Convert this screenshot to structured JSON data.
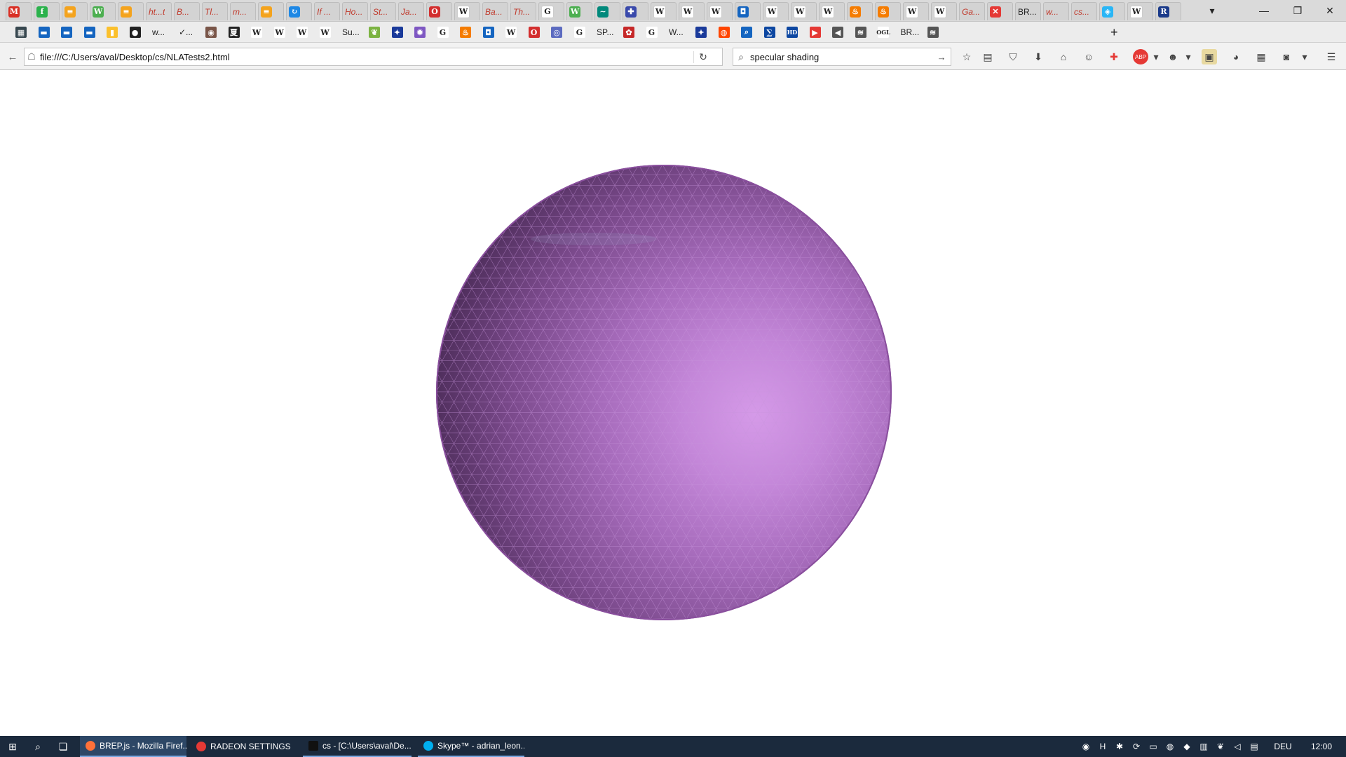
{
  "window": {
    "tabs": [
      {
        "title": "",
        "icon": "gmail-icon",
        "color": "#d93025",
        "glyph": "M"
      },
      {
        "title": "",
        "icon": "feedly-icon",
        "color": "#2bb24c",
        "glyph": "f"
      },
      {
        "title": "",
        "icon": "menu-icon",
        "color": "#f4a31d",
        "glyph": "≡"
      },
      {
        "title": "",
        "icon": "wolfram-icon",
        "color": "#4caf50",
        "glyph": "W"
      },
      {
        "title": "",
        "icon": "menu-icon",
        "color": "#f4a31d",
        "glyph": "≡"
      },
      {
        "title": "ht...t",
        "icon": "",
        "color": "",
        "glyph": ""
      },
      {
        "title": "B...",
        "icon": "",
        "color": "",
        "glyph": ""
      },
      {
        "title": "Tl...",
        "icon": "",
        "color": "",
        "glyph": ""
      },
      {
        "title": "m...",
        "icon": "",
        "color": "",
        "glyph": ""
      },
      {
        "title": "",
        "icon": "menu-icon",
        "color": "#f4a31d",
        "glyph": "≡"
      },
      {
        "title": "",
        "icon": "refresh-blue-icon",
        "color": "#1e88e5",
        "glyph": "↻"
      },
      {
        "title": "If ...",
        "icon": "",
        "color": "",
        "glyph": ""
      },
      {
        "title": "Ho...",
        "icon": "",
        "color": "",
        "glyph": ""
      },
      {
        "title": "St...",
        "icon": "",
        "color": "",
        "glyph": ""
      },
      {
        "title": "Ja...",
        "icon": "",
        "color": "",
        "glyph": ""
      },
      {
        "title": "",
        "icon": "opera-icon",
        "color": "#d32f2f",
        "glyph": "O"
      },
      {
        "title": "",
        "icon": "wikipedia-icon",
        "color": "#ffffff",
        "glyph": "W"
      },
      {
        "title": "Ba...",
        "icon": "",
        "color": "",
        "glyph": ""
      },
      {
        "title": "Th...",
        "icon": "",
        "color": "",
        "glyph": ""
      },
      {
        "title": "",
        "icon": "google-icon",
        "color": "#ffffff",
        "glyph": "G"
      },
      {
        "title": "",
        "icon": "wolfram-icon",
        "color": "#4caf50",
        "glyph": "W"
      },
      {
        "title": "",
        "icon": "signature-icon",
        "color": "#00897b",
        "glyph": "∼"
      },
      {
        "title": "",
        "icon": "crest-icon",
        "color": "#3949ab",
        "glyph": "✚"
      },
      {
        "title": "",
        "icon": "wikipedia-icon",
        "color": "#ffffff",
        "glyph": "W"
      },
      {
        "title": "",
        "icon": "wikipedia-icon",
        "color": "#ffffff",
        "glyph": "W"
      },
      {
        "title": "",
        "icon": "wikipedia-icon",
        "color": "#ffffff",
        "glyph": "W"
      },
      {
        "title": "",
        "icon": "box-blue-icon",
        "color": "#1565c0",
        "glyph": "◘"
      },
      {
        "title": "",
        "icon": "wikipedia-icon",
        "color": "#ffffff",
        "glyph": "W"
      },
      {
        "title": "",
        "icon": "wikipedia-icon",
        "color": "#ffffff",
        "glyph": "W"
      },
      {
        "title": "",
        "icon": "wikipedia-icon",
        "color": "#ffffff",
        "glyph": "W"
      },
      {
        "title": "",
        "icon": "java-icon",
        "color": "#f57c00",
        "glyph": "♨"
      },
      {
        "title": "",
        "icon": "java-icon",
        "color": "#f57c00",
        "glyph": "♨"
      },
      {
        "title": "",
        "icon": "wikipedia-icon",
        "color": "#ffffff",
        "glyph": "W"
      },
      {
        "title": "",
        "icon": "wikipedia-icon",
        "color": "#ffffff",
        "glyph": "W"
      },
      {
        "title": "Ga...",
        "icon": "",
        "color": "",
        "glyph": ""
      },
      {
        "title": "",
        "icon": "close-red-icon",
        "color": "#e53935",
        "glyph": "✕"
      },
      {
        "title": "BR...",
        "icon": "",
        "color": "",
        "glyph": ""
      },
      {
        "title": "w...",
        "icon": "",
        "color": "",
        "glyph": ""
      },
      {
        "title": "cs...",
        "icon": "",
        "color": "",
        "glyph": ""
      },
      {
        "title": "",
        "icon": "layers-icon",
        "color": "#29b6f6",
        "glyph": "◈"
      },
      {
        "title": "",
        "icon": "wikipedia-icon",
        "color": "#ffffff",
        "glyph": "W"
      },
      {
        "title": "",
        "icon": "rwth-icon",
        "color": "#1a3a8a",
        "glyph": "R"
      }
    ],
    "tab_list_icon": "▾",
    "minimize_icon": "—",
    "restore_icon": "❐",
    "close_icon": "✕"
  },
  "bookmarks": [
    {
      "label": "",
      "icon": "bookmark-app-icon",
      "color": "#37474f",
      "glyph": "▦"
    },
    {
      "label": "",
      "icon": "bookmark-site-icon",
      "color": "#1565c0",
      "glyph": "▬"
    },
    {
      "label": "",
      "icon": "bookmark-site-icon",
      "color": "#1565c0",
      "glyph": "▬"
    },
    {
      "label": "",
      "icon": "bookmark-site-icon",
      "color": "#1565c0",
      "glyph": "▬"
    },
    {
      "label": "",
      "icon": "bookmark-badge-icon",
      "color": "#fbc02d",
      "glyph": "▮"
    },
    {
      "label": "",
      "icon": "github-icon",
      "color": "#222222",
      "glyph": "●"
    },
    {
      "label": "w...",
      "icon": "",
      "color": "",
      "glyph": ""
    },
    {
      "label": "✓...",
      "icon": "",
      "color": "",
      "glyph": ""
    },
    {
      "label": "",
      "icon": "owl-icon",
      "color": "#795548",
      "glyph": "◉"
    },
    {
      "label": "",
      "icon": "kanji-icon",
      "color": "#222222",
      "glyph": "夏"
    },
    {
      "label": "",
      "icon": "wikipedia-icon",
      "color": "#ffffff",
      "glyph": "W"
    },
    {
      "label": "",
      "icon": "wikipedia-icon",
      "color": "#ffffff",
      "glyph": "W"
    },
    {
      "label": "",
      "icon": "wikipedia-icon",
      "color": "#ffffff",
      "glyph": "W"
    },
    {
      "label": "",
      "icon": "wikipedia-icon",
      "color": "#ffffff",
      "glyph": "W"
    },
    {
      "label": "Su...",
      "icon": "",
      "color": "",
      "glyph": ""
    },
    {
      "label": "",
      "icon": "leaf-icon",
      "color": "#7cb342",
      "glyph": "❦"
    },
    {
      "label": "",
      "icon": "eu-flag-icon",
      "color": "#1a3a9a",
      "glyph": "✦"
    },
    {
      "label": "",
      "icon": "pattern-icon",
      "color": "#7e57c2",
      "glyph": "✹"
    },
    {
      "label": "",
      "icon": "google-icon",
      "color": "#ffffff",
      "glyph": "G"
    },
    {
      "label": "",
      "icon": "java-icon",
      "color": "#f57c00",
      "glyph": "♨"
    },
    {
      "label": "",
      "icon": "box-blue-icon",
      "color": "#1565c0",
      "glyph": "◘"
    },
    {
      "label": "",
      "icon": "wikipedia-icon",
      "color": "#ffffff",
      "glyph": "W"
    },
    {
      "label": "",
      "icon": "opera-icon",
      "color": "#d32f2f",
      "glyph": "O"
    },
    {
      "label": "",
      "icon": "globe-icon",
      "color": "#5c6bc0",
      "glyph": "◎"
    },
    {
      "label": "",
      "icon": "google-icon",
      "color": "#ffffff",
      "glyph": "G"
    },
    {
      "label": "SP...",
      "icon": "",
      "color": "",
      "glyph": ""
    },
    {
      "label": "",
      "icon": "gear-red-icon",
      "color": "#c62828",
      "glyph": "✿"
    },
    {
      "label": "",
      "icon": "google-icon",
      "color": "#ffffff",
      "glyph": "G"
    },
    {
      "label": "W...",
      "icon": "",
      "color": "",
      "glyph": ""
    },
    {
      "label": "",
      "icon": "eu-flag-icon",
      "color": "#1a3a9a",
      "glyph": "✦"
    },
    {
      "label": "",
      "icon": "reddit-icon",
      "color": "#ff4500",
      "glyph": "◍"
    },
    {
      "label": "",
      "icon": "search-blue-icon",
      "color": "#1565c0",
      "glyph": "⌕"
    },
    {
      "label": "",
      "icon": "formula-icon",
      "color": "#0d47a1",
      "glyph": "∑"
    },
    {
      "label": "",
      "icon": "hd-icon",
      "color": "#0d47a1",
      "glyph": "HD"
    },
    {
      "label": "",
      "icon": "youtube-icon",
      "color": "#e53935",
      "glyph": "▶"
    },
    {
      "label": "",
      "icon": "speaker-icon",
      "color": "#555555",
      "glyph": "◀"
    },
    {
      "label": "",
      "icon": "wave-icon",
      "color": "#555555",
      "glyph": "≋"
    },
    {
      "label": "",
      "icon": "ogl-icon",
      "color": "#ffffff",
      "glyph": "OGL"
    },
    {
      "label": "BR...",
      "icon": "",
      "color": "",
      "glyph": ""
    },
    {
      "label": "",
      "icon": "wave-icon",
      "color": "#555555",
      "glyph": "≋"
    }
  ],
  "nav": {
    "url": "file:///C:/Users/aval/Desktop/cs/NLATests2.html",
    "search_query": "specular shading",
    "back_icon": "←",
    "site_icon": "☖",
    "reload_icon": "↻",
    "search_icon": "⌕",
    "search_go_icon": "→"
  },
  "toolbar": [
    {
      "icon": "bookmark-star-icon",
      "glyph": "☆"
    },
    {
      "icon": "reader-list-icon",
      "glyph": "▤"
    },
    {
      "icon": "pocket-icon",
      "glyph": "⛉"
    },
    {
      "icon": "download-icon",
      "glyph": "⬇"
    },
    {
      "icon": "home-icon",
      "glyph": "⌂"
    },
    {
      "icon": "chat-icon",
      "glyph": "☺"
    },
    {
      "icon": "addon-red-icon",
      "glyph": "✚"
    },
    {
      "icon": "adblock-icon",
      "glyph": "ABP"
    },
    {
      "icon": "dropdown-icon",
      "glyph": "▾"
    },
    {
      "icon": "greasemonkey-icon",
      "glyph": "☻"
    },
    {
      "icon": "dropdown-icon",
      "glyph": "▾"
    },
    {
      "icon": "screenshot-icon",
      "glyph": "▣"
    },
    {
      "icon": "color-picker-icon",
      "glyph": "◕"
    },
    {
      "icon": "qr-code-icon",
      "glyph": "▦"
    },
    {
      "icon": "camera-icon",
      "glyph": "◙"
    },
    {
      "icon": "dropdown-icon",
      "glyph": "▾"
    },
    {
      "icon": "hamburger-menu-icon",
      "glyph": "☰"
    }
  ],
  "taskbar": {
    "start_icon": "⊞",
    "search_icon": "⌕",
    "task_view_icon": "❏",
    "apps": [
      {
        "label": "BREP.js - Mozilla Firef...",
        "icon": "firefox-icon",
        "color": "#ff7139",
        "state": "active"
      },
      {
        "label": "RADEON SETTINGS",
        "icon": "radeon-icon",
        "color": "#e53935",
        "state": "none"
      },
      {
        "label": "cs - [C:\\Users\\aval\\De...",
        "icon": "webstorm-icon",
        "color": "#111111",
        "state": "open"
      },
      {
        "label": "Skype™ - adrian_leon...",
        "icon": "skype-icon",
        "color": "#00aff0",
        "state": "open"
      }
    ],
    "tray": [
      {
        "icon": "tray-globe-icon",
        "glyph": "◉"
      },
      {
        "icon": "tray-h-icon",
        "glyph": "H"
      },
      {
        "icon": "tray-bug-icon",
        "glyph": "✱"
      },
      {
        "icon": "tray-sync-icon",
        "glyph": "⟳"
      },
      {
        "icon": "tray-device-icon",
        "glyph": "▭"
      },
      {
        "icon": "tray-disk-icon",
        "glyph": "◍"
      },
      {
        "icon": "tray-shield-icon",
        "glyph": "◆"
      },
      {
        "icon": "tray-network-icon",
        "glyph": "▥"
      },
      {
        "icon": "tray-leaf-icon",
        "glyph": "❦"
      },
      {
        "icon": "tray-volume-icon",
        "glyph": "◁"
      },
      {
        "icon": "tray-notification-icon",
        "glyph": "▤"
      }
    ],
    "language": "DEU",
    "clock": "12:00"
  }
}
